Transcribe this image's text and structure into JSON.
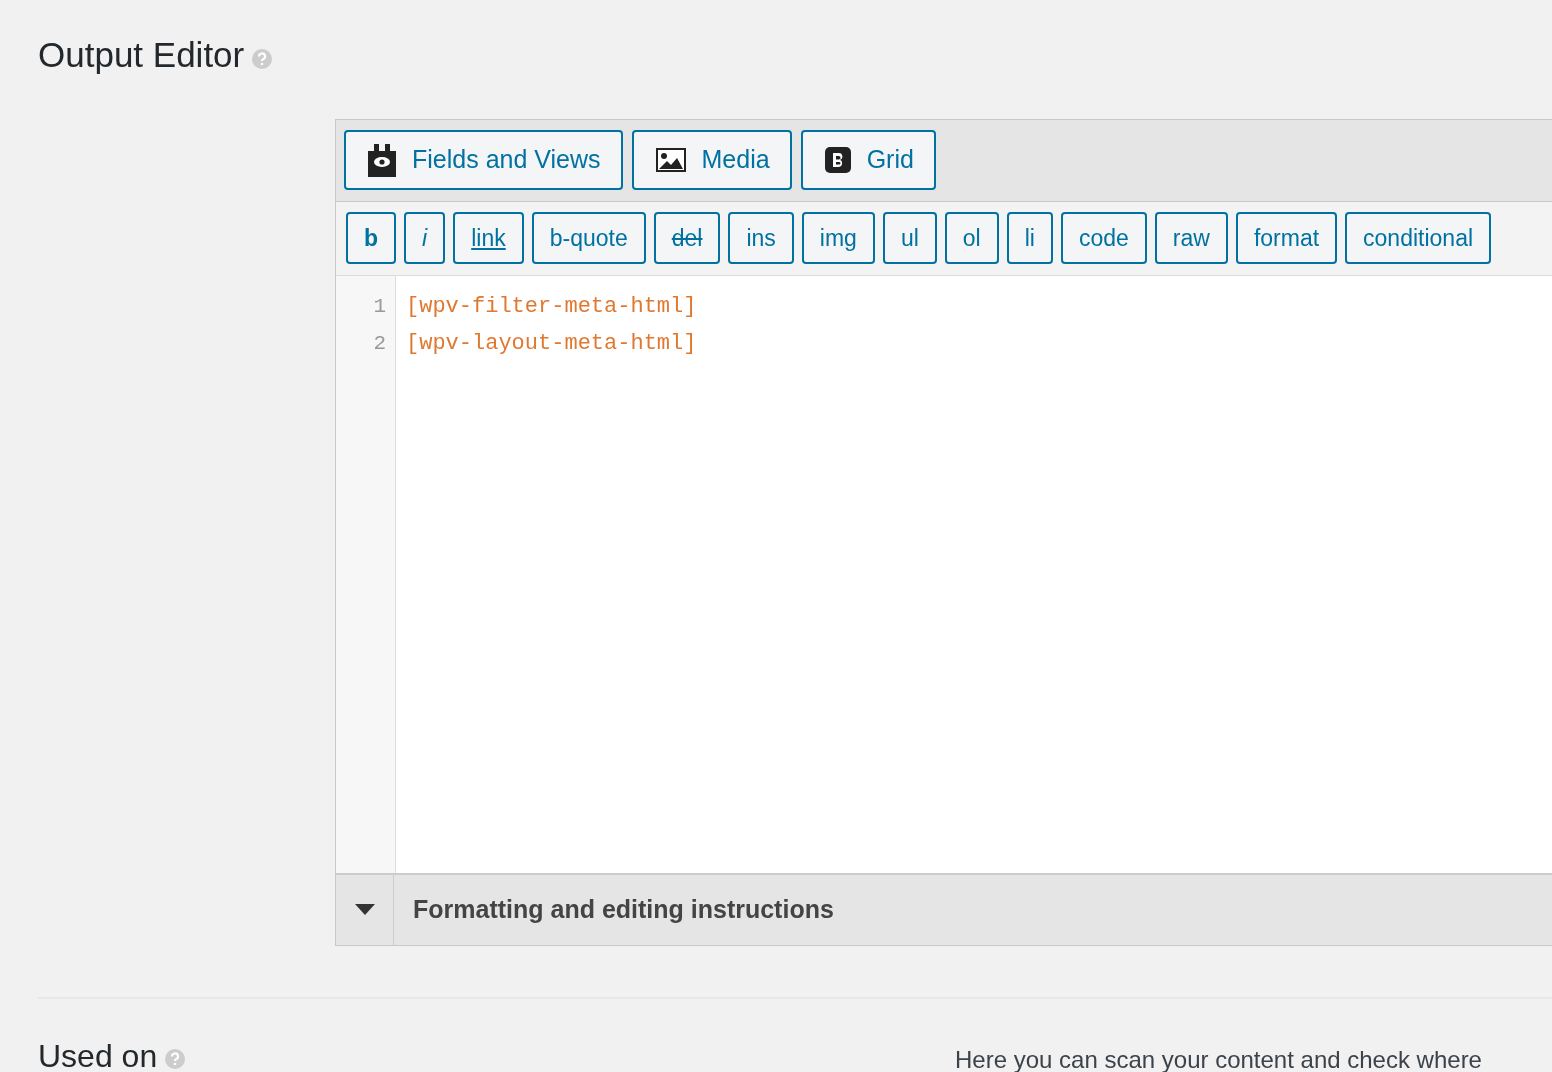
{
  "section_title": "Output Editor",
  "toolbar_buttons": [
    {
      "label": "Fields and Views",
      "kind": "fields"
    },
    {
      "label": "Media",
      "kind": "media"
    },
    {
      "label": "Grid",
      "kind": "grid"
    }
  ],
  "quicktags": [
    {
      "label": "b",
      "kind": "bold"
    },
    {
      "label": "i",
      "kind": "italic"
    },
    {
      "label": "link",
      "kind": "underline"
    },
    {
      "label": "b-quote",
      "kind": "plain"
    },
    {
      "label": "del",
      "kind": "strike"
    },
    {
      "label": "ins",
      "kind": "plain"
    },
    {
      "label": "img",
      "kind": "plain"
    },
    {
      "label": "ul",
      "kind": "plain"
    },
    {
      "label": "ol",
      "kind": "plain"
    },
    {
      "label": "li",
      "kind": "plain"
    },
    {
      "label": "code",
      "kind": "plain"
    },
    {
      "label": "raw",
      "kind": "plain"
    },
    {
      "label": "format",
      "kind": "plain"
    },
    {
      "label": "conditional",
      "kind": "plain"
    }
  ],
  "code_lines": [
    {
      "number": "1",
      "text": "[wpv-filter-meta-html]"
    },
    {
      "number": "2",
      "text": "[wpv-layout-meta-html]"
    }
  ],
  "instructions": {
    "label": "Formatting and editing instructions",
    "expanded": false
  },
  "next_section": {
    "title": "Used on",
    "description": "Here you can scan your content and check where"
  }
}
